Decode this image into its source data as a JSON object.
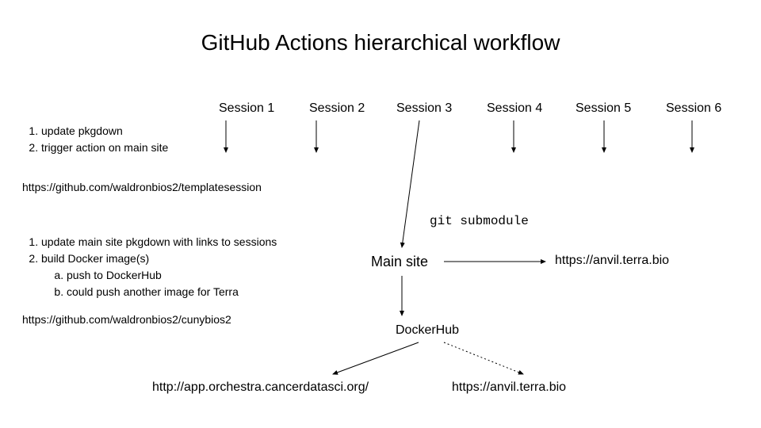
{
  "title": "GitHub Actions hierarchical workflow",
  "sessions": [
    "Session 1",
    "Session 2",
    "Session 3",
    "Session 4",
    "Session 5",
    "Session 6"
  ],
  "top_steps": {
    "s1": "update pkgdown",
    "s2": "trigger action on main site"
  },
  "url_template": "https://github.com/waldronbios2/templatesession",
  "mid_steps": {
    "s1": "update main site pkgdown with links to sessions",
    "s2": "build Docker image(s)",
    "s2a": "push to DockerHub",
    "s2b": "could push another image for Terra"
  },
  "url_cunybios": "https://github.com/waldronbios2/cunybios2",
  "git_submodule": "git submodule",
  "main_site": "Main site",
  "anvil_top": "https://anvil.terra.bio",
  "dockerhub": "DockerHub",
  "orchestra": "http://app.orchestra.cancerdatasci.org/",
  "anvil_bottom": "https://anvil.terra.bio"
}
